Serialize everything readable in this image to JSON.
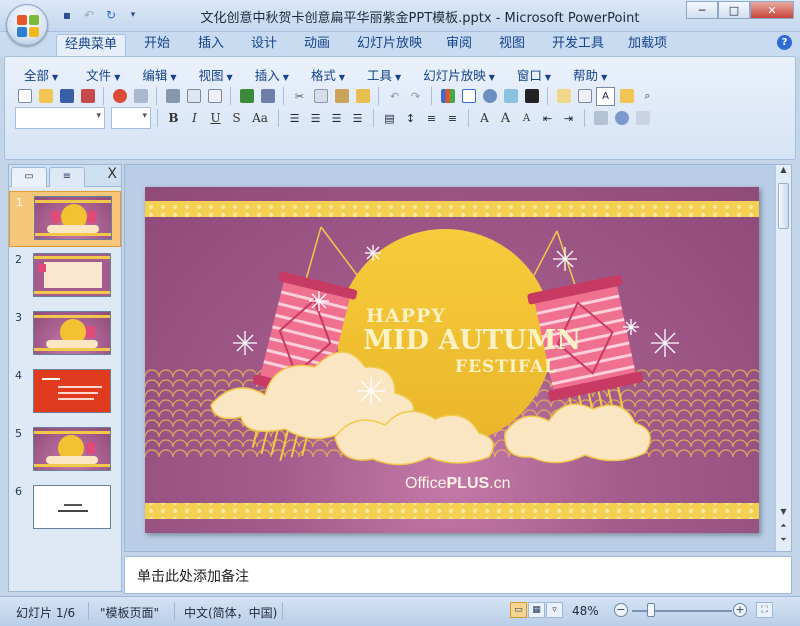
{
  "window": {
    "title": "文化创意中秋贺卡创意扁平华丽紫金PPT模板.pptx - Microsoft PowerPoint",
    "minimize": "─",
    "maximize": "□",
    "close": "✕"
  },
  "qat": {
    "save": "💾",
    "undo": "↶",
    "redo": "↻",
    "customize": "▾"
  },
  "tabs": [
    "经典菜单",
    "开始",
    "插入",
    "设计",
    "动画",
    "幻灯片放映",
    "审阅",
    "视图",
    "开发工具",
    "加载项"
  ],
  "help": "?",
  "menu": [
    "全部",
    "文件",
    "编辑",
    "视图",
    "插入",
    "格式",
    "工具",
    "幻灯片放映",
    "窗口",
    "帮助"
  ],
  "format_buttons": {
    "bold": "B",
    "italic": "I",
    "underline": "U",
    "shadow": "S",
    "case": "Aa",
    "font_color": "A",
    "grow": "A",
    "shrink": "A"
  },
  "pane": {
    "close": "X"
  },
  "slides": [
    {
      "num": "1",
      "kind": "festival"
    },
    {
      "num": "2",
      "kind": "table"
    },
    {
      "num": "3",
      "kind": "festival"
    },
    {
      "num": "4",
      "kind": "red"
    },
    {
      "num": "5",
      "kind": "festival"
    },
    {
      "num": "6",
      "kind": "blank"
    }
  ],
  "slide_main": {
    "line1": "HAPPY",
    "line2": "MID AUTUMN",
    "line3": "FESTIFAL",
    "brand_a": "Office",
    "brand_b": "PLUS",
    "brand_c": ".cn"
  },
  "notes_placeholder": "单击此处添加备注",
  "status": {
    "slide_info": "幻灯片 1/6",
    "theme": "\"模板页面\"",
    "language": "中文(简体，中国)",
    "zoom": "48%",
    "zoom_out": "−",
    "zoom_in": "+"
  },
  "colors": {
    "slide_purple": "#8f4a7a",
    "moon": "#f2c233",
    "lantern": "#e04a78",
    "gold_border": "#f0c94a",
    "selected_thumb": "#f6c67a"
  }
}
